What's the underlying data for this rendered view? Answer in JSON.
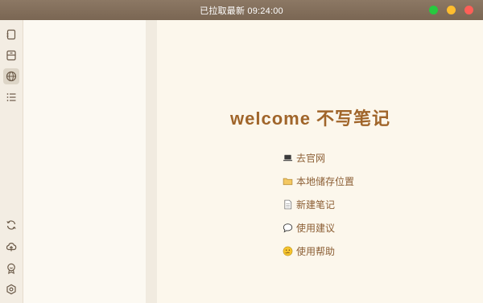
{
  "window": {
    "title": "已拉取最新 09:24:00"
  },
  "rail": {
    "top_icons": [
      "notebook-icon",
      "archive-icon",
      "globe-icon",
      "list-icon"
    ],
    "bottom_icons": [
      "sync-icon",
      "cloud-upload-icon",
      "badge-icon",
      "settings-icon"
    ],
    "active": "globe-icon"
  },
  "main": {
    "welcome": "welcome 不写笔记",
    "actions": [
      {
        "label": "去官网",
        "icon": "laptop-icon"
      },
      {
        "label": "本地储存位置",
        "icon": "folder-icon"
      },
      {
        "label": "新建笔记",
        "icon": "document-icon"
      },
      {
        "label": "使用建议",
        "icon": "speech-bubble-icon"
      },
      {
        "label": "使用帮助",
        "icon": "thinking-face-icon"
      }
    ]
  },
  "colors": {
    "accent": "#a0652a",
    "titlebar": "#7a6653",
    "background": "#fcf7ec"
  }
}
